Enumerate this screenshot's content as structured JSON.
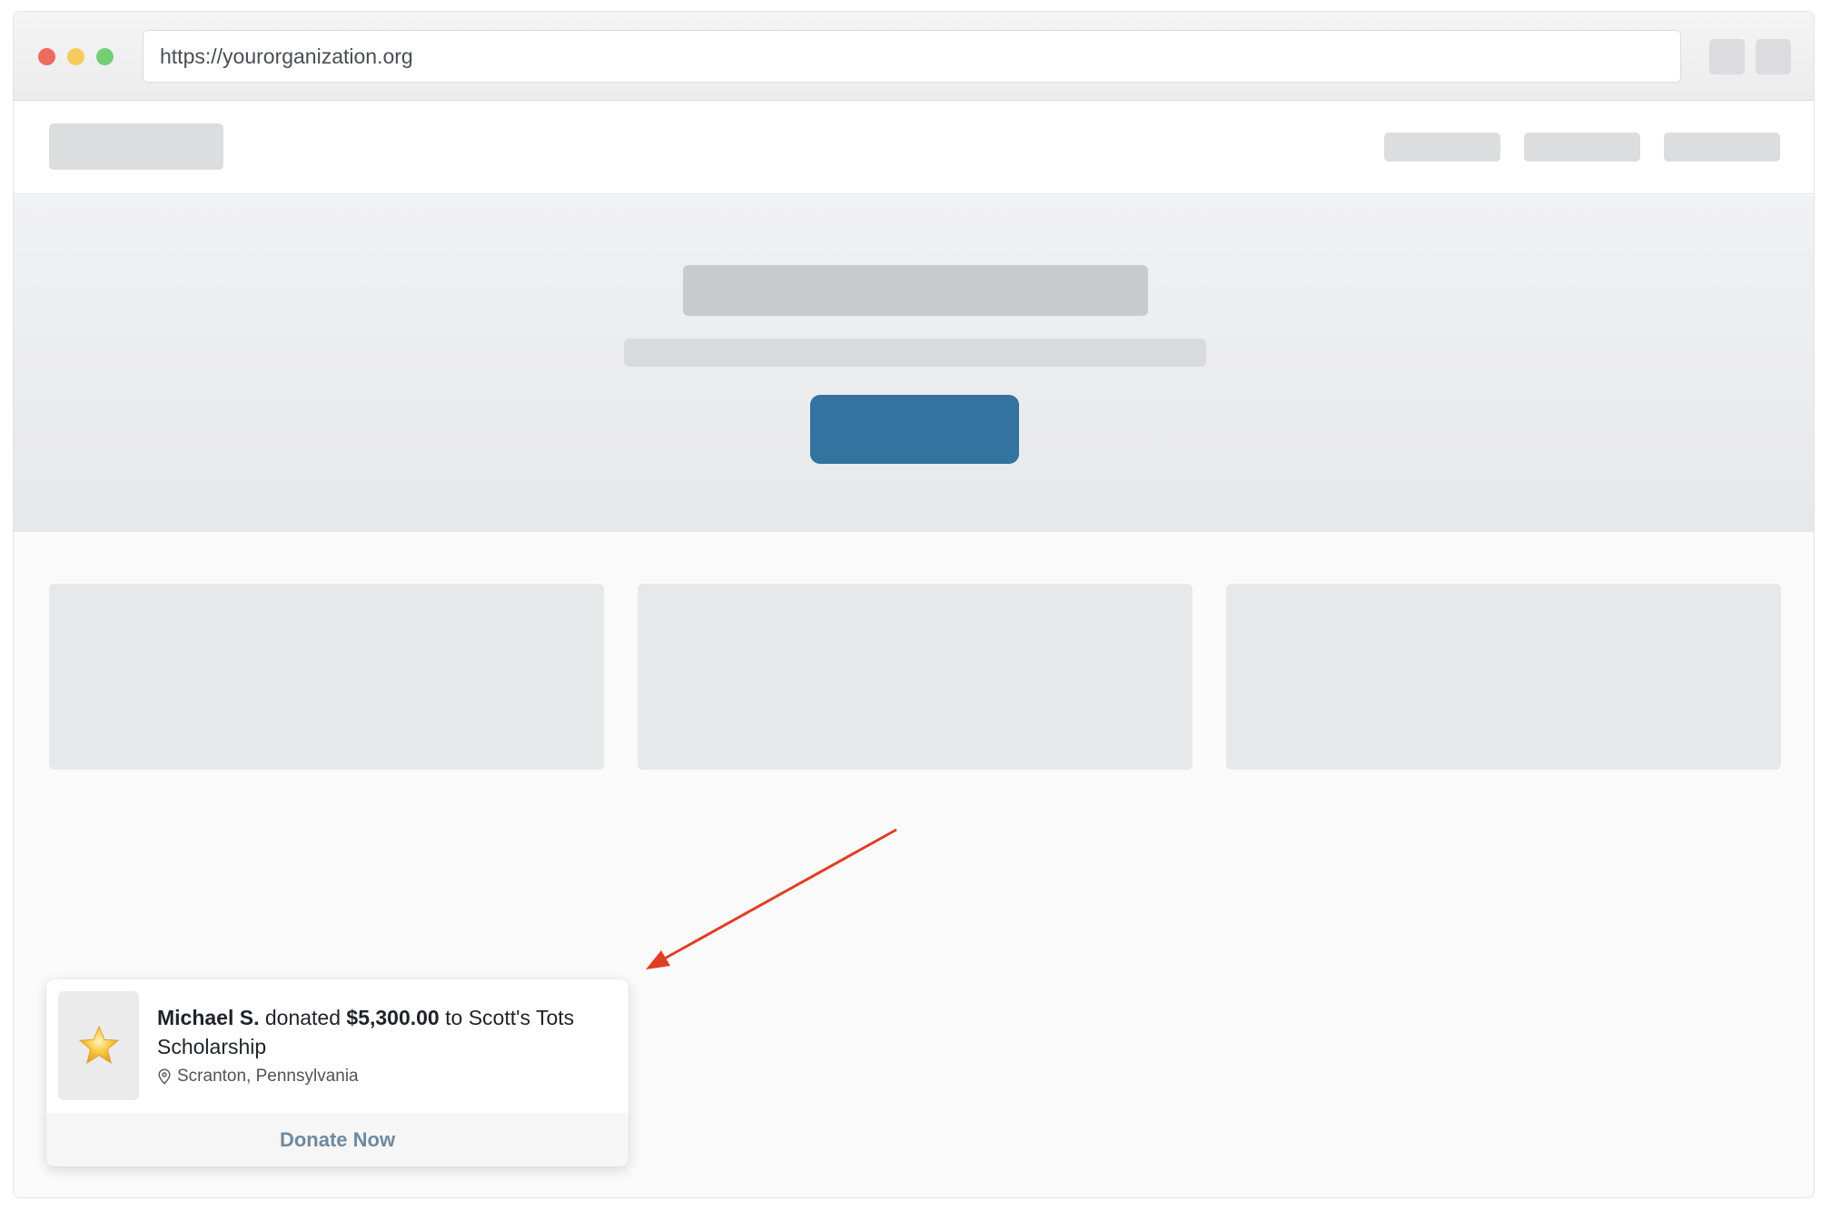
{
  "browser": {
    "url": "https://yourorganization.org"
  },
  "notification": {
    "icon": "star-icon",
    "donor_name": "Michael S.",
    "verb": "donated",
    "amount": "$5,300.00",
    "connector": "to",
    "campaign": "Scott's Tots Scholarship",
    "location": "Scranton, Pennsylvania",
    "cta_label": "Donate Now"
  },
  "colors": {
    "primary_button": "#32739f",
    "arrow": "#e03e24",
    "cta_text": "#6e8aa0"
  }
}
